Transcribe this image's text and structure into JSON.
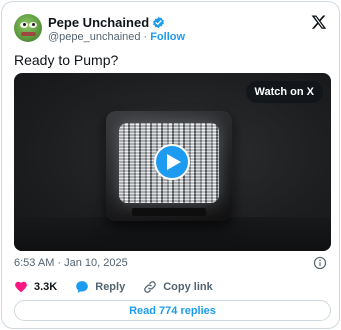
{
  "author": {
    "display_name": "Pepe Unchained",
    "handle": "@pepe_unchained",
    "separator": "·",
    "follow_label": "Follow",
    "verified": true
  },
  "tweet": {
    "text": "Ready to Pump?",
    "timestamp": "6:53 AM · Jan 10, 2025"
  },
  "media": {
    "type": "video",
    "watch_label": "Watch on X"
  },
  "actions": {
    "like_count": "3.3K",
    "reply_label": "Reply",
    "copy_label": "Copy link"
  },
  "read_replies_label": "Read 774 replies",
  "icons": {
    "logo": "x-logo-icon",
    "verified": "verified-badge-icon",
    "play": "play-icon",
    "info": "info-icon",
    "like": "heart-icon",
    "reply": "reply-bubble-icon",
    "copy": "link-icon"
  },
  "colors": {
    "accent": "#1d9bf0",
    "like": "#f91880",
    "text": "#0f1419",
    "muted": "#536471",
    "border": "#cfd9de"
  }
}
